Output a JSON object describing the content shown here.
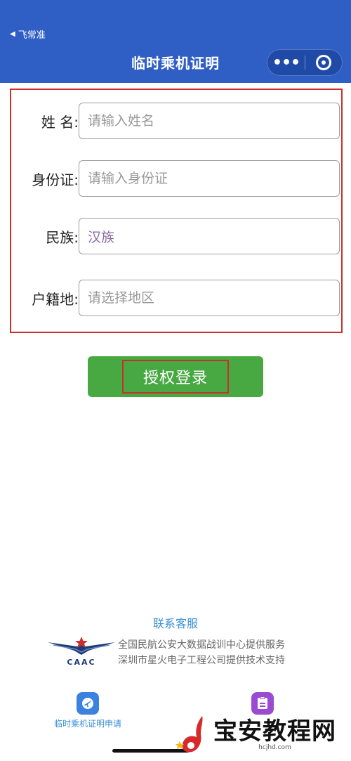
{
  "header": {
    "back_label": "飞常准",
    "title": "临时乘机证明",
    "menu_icon": "more-dots-icon",
    "close_icon": "target-icon"
  },
  "form": {
    "name": {
      "label": "姓 名:",
      "placeholder": "请输入姓名"
    },
    "id_card": {
      "label": "身份证:",
      "placeholder": "请输入身份证"
    },
    "ethnicity": {
      "label": "民族:",
      "value": "汉族"
    },
    "domicile": {
      "label": "户籍地:",
      "placeholder": "请选择地区"
    }
  },
  "login_button": {
    "label": "授权登录"
  },
  "footer": {
    "contact": "联系客服",
    "caac": "CAAC",
    "line1": "全国民航公安大数据战训中心提供服务",
    "line2": "深圳市星火电子工程公司提供技术支持"
  },
  "tabbar": {
    "left_label": "临时乘机证明申请"
  },
  "watermark": {
    "title": "宝安教程网",
    "url": "hcjhd.com"
  },
  "colors": {
    "header": "#2f5fc4",
    "highlight": "#c9302c",
    "button": "#48a842",
    "link": "#3a8fd6"
  }
}
